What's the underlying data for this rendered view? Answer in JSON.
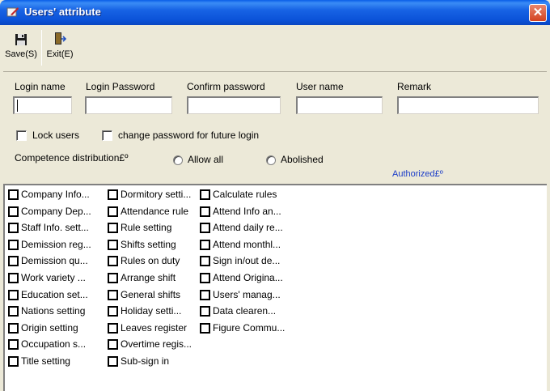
{
  "window": {
    "title": "Users' attribute",
    "close_glyph": "✕"
  },
  "toolbar": {
    "save_label": "Save(S)",
    "exit_label": "Exit(E)",
    "save_icon": "floppy-disk-icon",
    "exit_icon": "exit-door-icon"
  },
  "form": {
    "login_name_label": "Login name",
    "login_password_label": "Login Password",
    "confirm_password_label": "Confirm password",
    "user_name_label": "User name",
    "remark_label": "Remark",
    "login_name_value": "",
    "login_password_value": "",
    "confirm_password_value": "",
    "user_name_value": "",
    "remark_value": "",
    "lock_users_label": "Lock users",
    "change_password_label": "change password for future login",
    "competence_label": "Competence distribution£º",
    "allow_all_label": "Allow all",
    "abolished_label": "Abolished",
    "authorized_label": "Authorized£º"
  },
  "permissions": {
    "col1": [
      "Company Info...",
      "Company Dep...",
      "Staff Info. sett...",
      "Demission reg...",
      "Demission qu...",
      "Work variety ...",
      "Education set...",
      "Nations setting",
      "Origin setting",
      "Occupation s...",
      "Title setting"
    ],
    "col2": [
      "Dormitory setti...",
      "Attendance rule",
      "Rule setting",
      "Shifts setting",
      "Rules on duty",
      "Arrange shift",
      "General shifts",
      "Holiday setti...",
      "Leaves register",
      "Overtime regis...",
      "Sub-sign in"
    ],
    "col3": [
      "Calculate rules",
      "Attend Info an...",
      "Attend daily re...",
      "Attend monthl...",
      "Sign in/out de...",
      "Attend Origina...",
      "Users' manag...",
      "Data clearen...",
      "Figure Commu..."
    ]
  }
}
